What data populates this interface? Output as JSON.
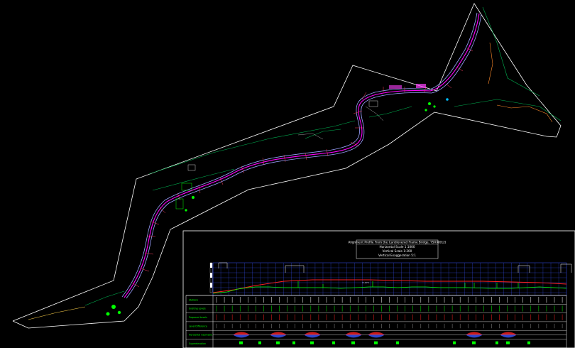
{
  "drawing": {
    "title_block": {
      "line1": "Alignment Profile From the Cantilevered Frame Bridge, Y5XX(012)",
      "line2": "Horizontal Scale 1:1000",
      "line3": "Vertical Scale 1:200",
      "line4": "Vertical Exaggeration 5:1"
    },
    "profile_rows": [
      {
        "key": "stations",
        "label": "Stations"
      },
      {
        "key": "existing",
        "label": "Existing Levels"
      },
      {
        "key": "proposed",
        "label": "Proposed Levels"
      },
      {
        "key": "difference",
        "label": "Level Difference"
      },
      {
        "key": "horizontal",
        "label": "Horizontal Geometry"
      },
      {
        "key": "superelevation",
        "label": "Superelevation"
      }
    ],
    "profile_marker": "0.675",
    "colors": {
      "background": "#000000",
      "boundary": "#ffffff",
      "alignment": "#ff00ff",
      "existing_ground": "#00ff00",
      "proposed_grade": "#ff0000",
      "grid": "#3a55ff",
      "road_edge": "#9aa0ff"
    }
  }
}
